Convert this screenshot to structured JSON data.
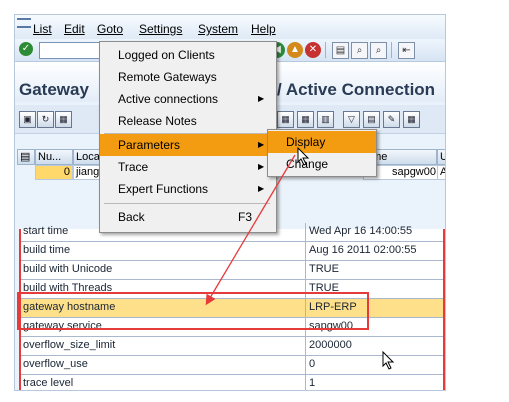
{
  "menubar": {
    "items": [
      "List",
      "Edit",
      "Goto",
      "Settings",
      "System",
      "Help"
    ]
  },
  "window": {
    "title_left": "Gateway",
    "title_right": "/ Active Connection"
  },
  "goto_menu": {
    "items": [
      {
        "label": "Logged on Clients"
      },
      {
        "label": "Remote Gateways"
      },
      {
        "label": "Active connections",
        "submenu": true
      },
      {
        "label": "Release Notes"
      },
      {
        "label": "Parameters",
        "submenu": true,
        "selected": true
      },
      {
        "label": "Trace",
        "submenu": true
      },
      {
        "label": "Expert Functions",
        "submenu": true
      },
      {
        "label": "Back",
        "accelerator": "F3"
      }
    ]
  },
  "parameters_submenu": {
    "items": [
      {
        "label": "Display",
        "selected": true
      },
      {
        "label": "Change"
      }
    ]
  },
  "client_table": {
    "headers": [
      "Nu...",
      "Loca",
      "ame",
      "U"
    ],
    "row": [
      "0",
      "jiang",
      "sapgw00",
      "A"
    ]
  },
  "details": {
    "rows": [
      {
        "label": "start time",
        "value": "Wed Apr 16 14:00:55"
      },
      {
        "label": "build time",
        "value": "Aug 16 2011 02:00:55"
      },
      {
        "label": "build with Unicode",
        "value": "TRUE"
      },
      {
        "label": "build with Threads",
        "value": "TRUE"
      },
      {
        "label": "gateway hostname",
        "value": "LRP-ERP"
      },
      {
        "label": "gateway service",
        "value": "sapgw00"
      },
      {
        "label": "overflow_size_limit",
        "value": "2000000"
      },
      {
        "label": "overflow_use",
        "value": "0"
      },
      {
        "label": "trace level",
        "value": "1"
      }
    ]
  },
  "colors": {
    "menu_highlight": "#f39c12",
    "annotation_red": "#e53b3b",
    "row_highlight": "#ffe08a"
  }
}
